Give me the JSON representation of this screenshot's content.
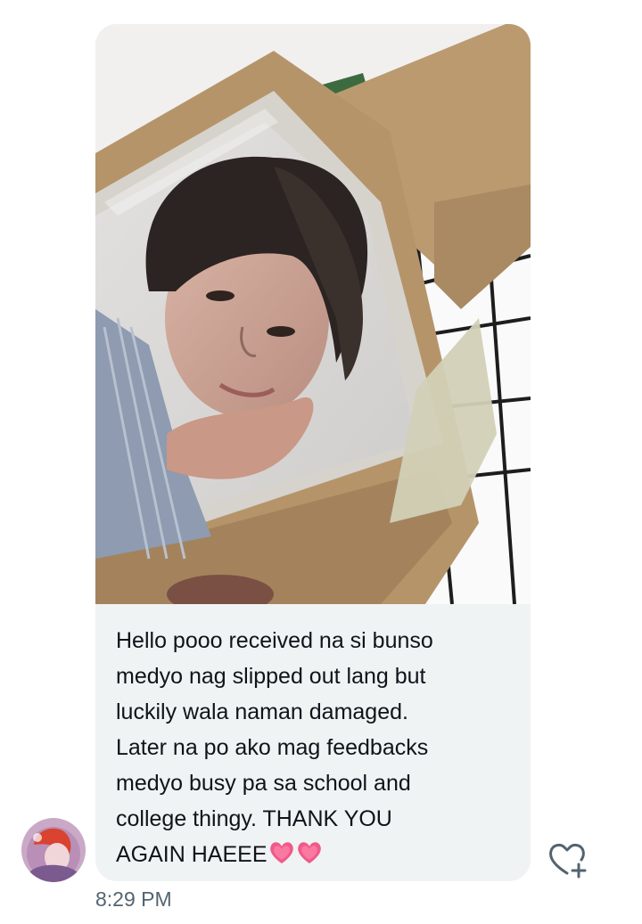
{
  "conversation": {
    "message": {
      "lines": [
        "Hello pooo received na si bunso",
        "medyo nag slipped out lang but",
        "luckily wala naman damaged.",
        "Later na po ako mag feedbacks",
        "medyo busy pa sa school and",
        "college thingy. THANK YOU",
        "AGAIN HAEEE"
      ],
      "emoji": [
        "pink-heart",
        "pink-heart"
      ],
      "timestamp": "8:29 PM"
    },
    "sender_avatar_icon": "user-avatar",
    "reaction_icon": "heart-plus-icon"
  },
  "colors": {
    "bubble": "#eff3f4",
    "text": "#0f1419",
    "timestamp": "#536471",
    "heart": "#f05a8a"
  }
}
